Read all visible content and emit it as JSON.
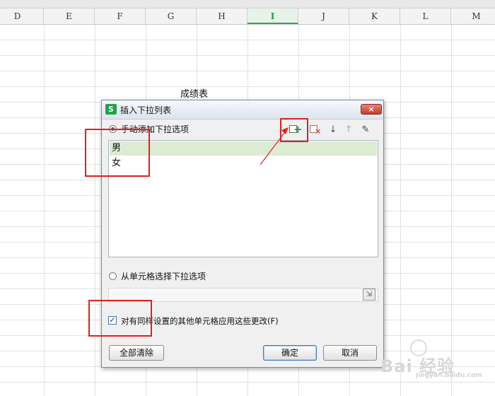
{
  "columns": [
    "D",
    "E",
    "F",
    "G",
    "H",
    "I",
    "J",
    "K",
    "L",
    "M"
  ],
  "active_column": "I",
  "sheet_title_cell": "成绩表",
  "dialog": {
    "title": "插入下拉列表",
    "close_label": "×",
    "option_manual": "手动添加下拉选项",
    "list_items": [
      "男",
      "女"
    ],
    "option_from_cells": "从单元格选择下拉选项",
    "apply_checkbox_label": "对有同样设置的其他单元格应用这些更改(F)",
    "apply_checkbox_checked": true,
    "clear_all_label": "全部清除",
    "ok_label": "确定",
    "cancel_label": "取消"
  },
  "watermark": {
    "text": "Bai 经验",
    "sub": "jingyan.baidu.com"
  },
  "colors": {
    "accent_green": "#2fa84f",
    "annotation_red": "#e02020",
    "selected_row": "#dcebd2"
  },
  "icons": [
    "add-item-icon",
    "delete-item-icon",
    "move-down-icon",
    "move-up-icon",
    "edit-item-icon",
    "range-select-icon",
    "app-logo-icon"
  ]
}
